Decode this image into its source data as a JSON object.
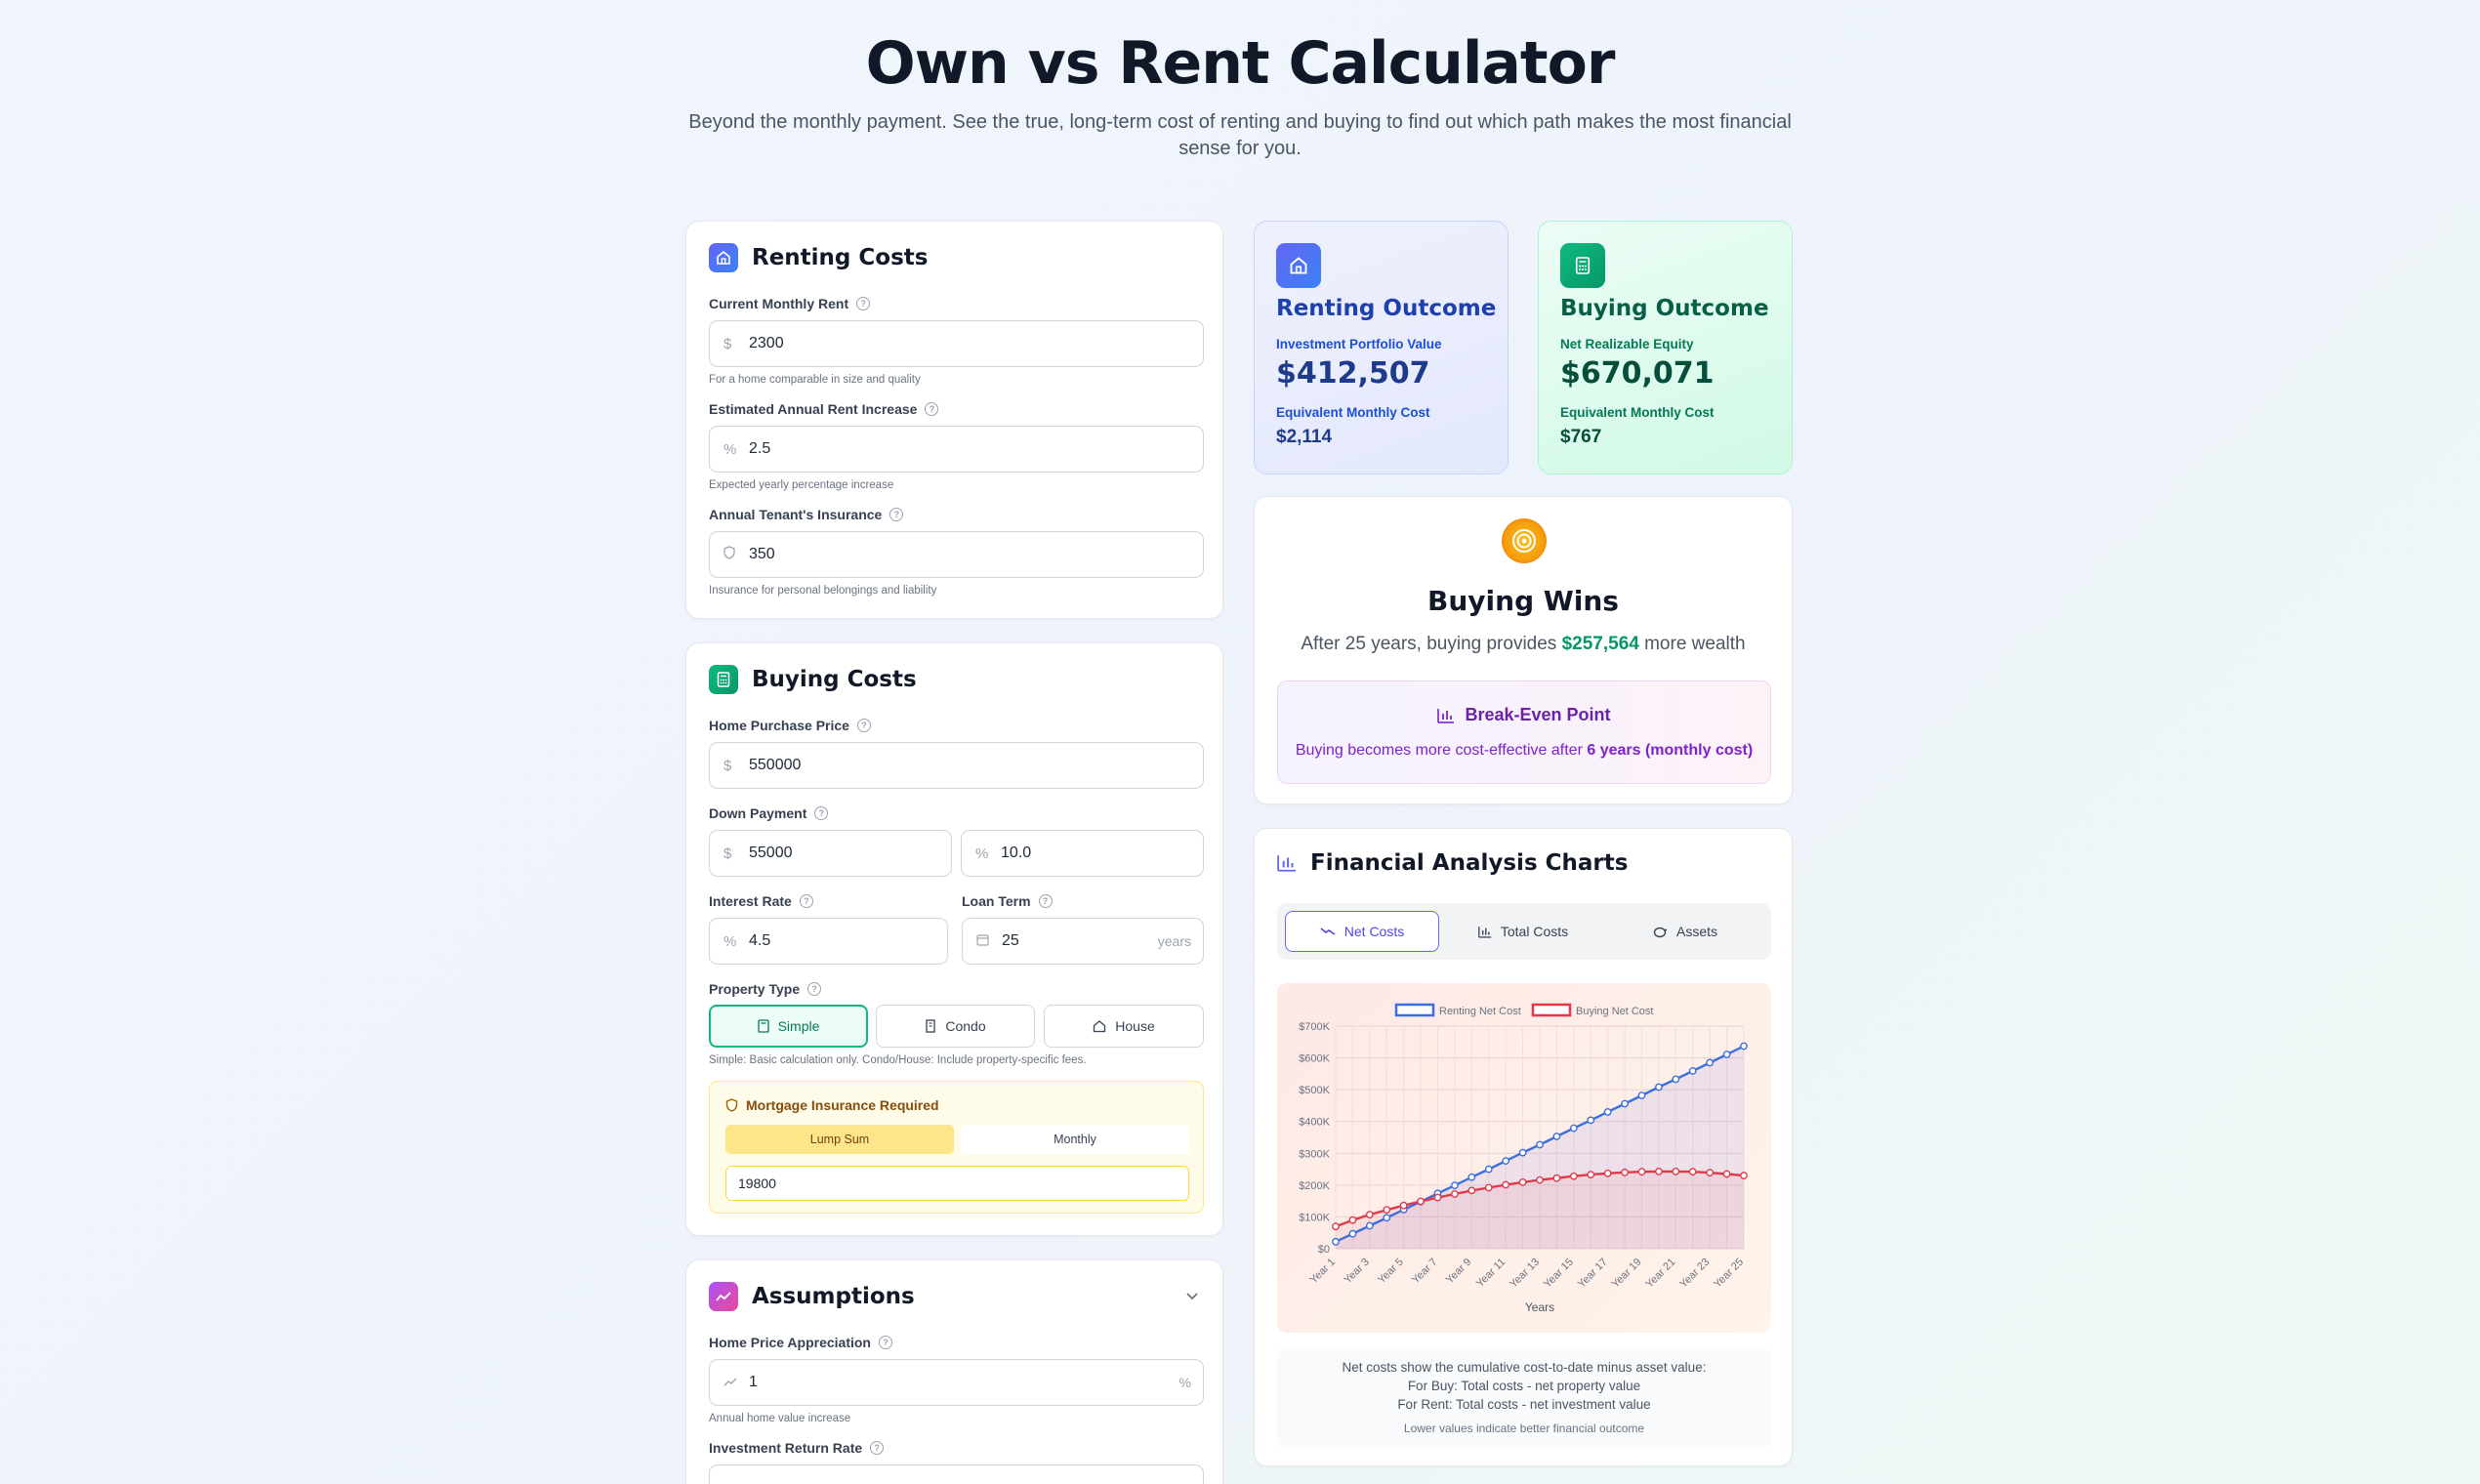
{
  "header": {
    "title": "Own vs Rent Calculator",
    "subtitle": "Beyond the monthly payment. See the true, long-term cost of renting and buying to find out which path makes the most financial sense for you."
  },
  "renting": {
    "title": "Renting Costs",
    "rent_label": "Current Monthly Rent",
    "rent_prefix": "$",
    "rent_value": "2300",
    "rent_help": "For a home comparable in size and quality",
    "increase_label": "Estimated Annual Rent Increase",
    "increase_prefix": "%",
    "increase_value": "2.5",
    "increase_help": "Expected yearly percentage increase",
    "insurance_label": "Annual Tenant's Insurance",
    "insurance_value": "350",
    "insurance_help": "Insurance for personal belongings and liability"
  },
  "buying": {
    "title": "Buying Costs",
    "price_label": "Home Purchase Price",
    "price_prefix": "$",
    "price_value": "550000",
    "down_label": "Down Payment",
    "down_prefix": "$",
    "down_value": "55000",
    "down_pct_prefix": "%",
    "down_pct_value": "10.0",
    "rate_label": "Interest Rate",
    "rate_prefix": "%",
    "rate_value": "4.5",
    "term_label": "Loan Term",
    "term_value": "25",
    "term_suffix": "years",
    "type_label": "Property Type",
    "types": [
      "Simple",
      "Condo",
      "House"
    ],
    "type_help": "Simple: Basic calculation only. Condo/House: Include property-specific fees.",
    "mortgage_title": "Mortgage Insurance Required",
    "mortgage_opt_lump": "Lump Sum",
    "mortgage_opt_monthly": "Monthly",
    "mortgage_value": "19800"
  },
  "assumptions": {
    "title": "Assumptions",
    "appreciation_label": "Home Price Appreciation",
    "appreciation_value": "1",
    "appreciation_suffix": "%",
    "appreciation_help": "Annual home value increase",
    "return_label": "Investment Return Rate"
  },
  "renting_outcome": {
    "title": "Renting Outcome",
    "portfolio_label": "Investment Portfolio Value",
    "portfolio_value": "$412,507",
    "monthly_label": "Equivalent Monthly Cost",
    "monthly_value": "$2,114"
  },
  "buying_outcome": {
    "title": "Buying Outcome",
    "equity_label": "Net Realizable Equity",
    "equity_value": "$670,071",
    "monthly_label": "Equivalent Monthly Cost",
    "monthly_value": "$767"
  },
  "verdict": {
    "title": "Buying Wins",
    "text_before": "After 25 years, buying provides ",
    "amount": "$257,564",
    "text_after": " more wealth",
    "breakeven_title": "Break-Even Point",
    "breakeven_before": "Buying becomes more cost-effective after ",
    "breakeven_bold": "6 years (monthly cost)"
  },
  "charts": {
    "title": "Financial Analysis Charts",
    "tabs": [
      "Net Costs",
      "Total Costs",
      "Assets"
    ],
    "note_line1": "Net costs show the cumulative cost-to-date minus asset value:",
    "note_line2": "For Buy: Total costs - net property value",
    "note_line3": "For Rent: Total costs - net investment value",
    "note_line4": "Lower values indicate better financial outcome"
  },
  "colors": {
    "renting": "#3b6fe0",
    "buying": "#e03a4a",
    "accent_green": "#10b981",
    "accent_purple": "#7e22ce"
  },
  "chart_data": {
    "type": "line",
    "title": "",
    "xlabel": "Years",
    "ylabel": "",
    "ylim": [
      0,
      700000
    ],
    "yticks": [
      "$0",
      "$100K",
      "$200K",
      "$300K",
      "$400K",
      "$500K",
      "$600K",
      "$700K"
    ],
    "x": [
      "Year 1",
      "Year 2",
      "Year 3",
      "Year 4",
      "Year 5",
      "Year 6",
      "Year 7",
      "Year 8",
      "Year 9",
      "Year 10",
      "Year 11",
      "Year 12",
      "Year 13",
      "Year 14",
      "Year 15",
      "Year 16",
      "Year 17",
      "Year 18",
      "Year 19",
      "Year 20",
      "Year 21",
      "Year 22",
      "Year 23",
      "Year 24",
      "Year 25"
    ],
    "xtick_labels": [
      "Year 1",
      "Year 3",
      "Year 5",
      "Year 7",
      "Year 9",
      "Year 11",
      "Year 13",
      "Year 15",
      "Year 17",
      "Year 19",
      "Year 21",
      "Year 23",
      "Year 25"
    ],
    "legend_position": "top",
    "series": [
      {
        "name": "Renting Net Cost",
        "color": "#3b6fe0",
        "values": [
          22000,
          47000,
          72000,
          97000,
          123000,
          148000,
          174000,
          199000,
          225000,
          250000,
          276000,
          302000,
          327000,
          353000,
          379000,
          404000,
          430000,
          456000,
          482000,
          508000,
          533000,
          559000,
          585000,
          611000,
          637000
        ]
      },
      {
        "name": "Buying Net Cost",
        "color": "#e03a4a",
        "values": [
          70000,
          90000,
          107000,
          122000,
          136000,
          149000,
          161000,
          172000,
          183000,
          192000,
          201000,
          209000,
          216000,
          222000,
          228000,
          233000,
          237000,
          240000,
          242000,
          243000,
          243000,
          242000,
          239000,
          235000,
          230000
        ]
      }
    ]
  }
}
